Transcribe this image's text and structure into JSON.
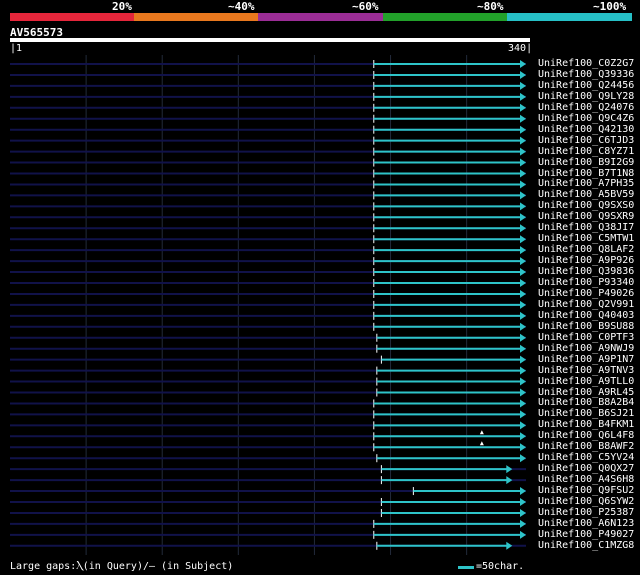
{
  "legend": {
    "labels": [
      "20%",
      "~40%",
      "~60%",
      "~80%",
      "~100%"
    ],
    "colors": [
      "#e5263b",
      "#e8781e",
      "#9b2d96",
      "#22a12a",
      "#26bfc6"
    ]
  },
  "query": {
    "name": "AV565573",
    "start": "1",
    "end": "340",
    "length": 340
  },
  "colors": {
    "background": "#000000",
    "grid": "#222a3a",
    "unaligned_line": "#11124a",
    "hit_line": "#2ec4c9",
    "text": "#ffffff"
  },
  "hits": [
    {
      "id": "UniRef100_C0Z2G7",
      "start": 240,
      "end": 340,
      "arrow": true
    },
    {
      "id": "UniRef100_Q39336",
      "start": 240,
      "end": 340,
      "arrow": true
    },
    {
      "id": "UniRef100_Q24456",
      "start": 240,
      "end": 340,
      "arrow": true
    },
    {
      "id": "UniRef100_Q9LY28",
      "start": 240,
      "end": 340,
      "arrow": true
    },
    {
      "id": "UniRef100_Q24076",
      "start": 240,
      "end": 340,
      "arrow": true
    },
    {
      "id": "UniRef100_Q9C4Z6",
      "start": 240,
      "end": 340,
      "arrow": true
    },
    {
      "id": "UniRef100_Q42130",
      "start": 240,
      "end": 340,
      "arrow": true
    },
    {
      "id": "UniRef100_C6TJD3",
      "start": 240,
      "end": 340,
      "arrow": true
    },
    {
      "id": "UniRef100_C8YZ71",
      "start": 240,
      "end": 340,
      "arrow": true
    },
    {
      "id": "UniRef100_B9I2G9",
      "start": 240,
      "end": 340,
      "arrow": true
    },
    {
      "id": "UniRef100_B7T1N8",
      "start": 240,
      "end": 340,
      "arrow": true
    },
    {
      "id": "UniRef100_A7PH35",
      "start": 240,
      "end": 340,
      "arrow": true
    },
    {
      "id": "UniRef100_A5BV59",
      "start": 240,
      "end": 340,
      "arrow": true
    },
    {
      "id": "UniRef100_Q9SXS0",
      "start": 240,
      "end": 340,
      "arrow": true
    },
    {
      "id": "UniRef100_Q9SXR9",
      "start": 240,
      "end": 340,
      "arrow": true
    },
    {
      "id": "UniRef100_Q38JI7",
      "start": 240,
      "end": 340,
      "arrow": true
    },
    {
      "id": "UniRef100_C5MTW1",
      "start": 240,
      "end": 340,
      "arrow": true
    },
    {
      "id": "UniRef100_Q8LAF2",
      "start": 240,
      "end": 340,
      "arrow": true
    },
    {
      "id": "UniRef100_A9P926",
      "start": 240,
      "end": 340,
      "arrow": true
    },
    {
      "id": "UniRef100_Q39836",
      "start": 240,
      "end": 340,
      "arrow": true
    },
    {
      "id": "UniRef100_P93340",
      "start": 240,
      "end": 340,
      "arrow": true
    },
    {
      "id": "UniRef100_P49026",
      "start": 240,
      "end": 340,
      "arrow": true
    },
    {
      "id": "UniRef100_Q2V991",
      "start": 240,
      "end": 340,
      "arrow": true
    },
    {
      "id": "UniRef100_Q40403",
      "start": 240,
      "end": 340,
      "arrow": true
    },
    {
      "id": "UniRef100_B9SU88",
      "start": 240,
      "end": 340,
      "arrow": true
    },
    {
      "id": "UniRef100_C0PTF3",
      "start": 242,
      "end": 340,
      "arrow": true
    },
    {
      "id": "UniRef100_A9NWJ9",
      "start": 242,
      "end": 340,
      "arrow": true
    },
    {
      "id": "UniRef100_A9P1N7",
      "start": 245,
      "end": 340,
      "arrow": true
    },
    {
      "id": "UniRef100_A9TNV3",
      "start": 242,
      "end": 340,
      "arrow": true
    },
    {
      "id": "UniRef100_A9TLL0",
      "start": 242,
      "end": 340,
      "arrow": true
    },
    {
      "id": "UniRef100_A9RL45",
      "start": 242,
      "end": 340,
      "arrow": true
    },
    {
      "id": "UniRef100_B8A2B4",
      "start": 240,
      "end": 340,
      "arrow": true
    },
    {
      "id": "UniRef100_B6SJ21",
      "start": 240,
      "end": 340,
      "arrow": true
    },
    {
      "id": "UniRef100_B4FKM1",
      "start": 240,
      "end": 340,
      "arrow": true
    },
    {
      "id": "UniRef100_Q6L4F8",
      "start": 240,
      "end": 340,
      "arrow": true
    },
    {
      "id": "UniRef100_B8AWF2",
      "start": 240,
      "end": 340,
      "arrow": true
    },
    {
      "id": "UniRef100_C5YV24",
      "start": 242,
      "end": 340,
      "arrow": true
    },
    {
      "id": "UniRef100_Q0QX27",
      "start": 245,
      "end": 331,
      "arrow": true
    },
    {
      "id": "UniRef100_A4S6H8",
      "start": 245,
      "end": 331,
      "arrow": true
    },
    {
      "id": "UniRef100_Q9FSU2",
      "start": 266,
      "end": 340,
      "arrow": true
    },
    {
      "id": "UniRef100_Q6SYW2",
      "start": 245,
      "end": 340,
      "arrow": true
    },
    {
      "id": "UniRef100_P25387",
      "start": 245,
      "end": 340,
      "arrow": true
    },
    {
      "id": "UniRef100_A6N123",
      "start": 240,
      "end": 340,
      "arrow": true
    },
    {
      "id": "UniRef100_P49027",
      "start": 240,
      "end": 340,
      "arrow": true
    },
    {
      "id": "UniRef100_C1MZG8",
      "start": 242,
      "end": 331,
      "arrow": true
    }
  ],
  "gap_markers": [
    {
      "row": 34,
      "pos": 311
    },
    {
      "row": 35,
      "pos": 311
    }
  ],
  "footer": {
    "text": "Large gaps:Ⲗ(in Query)/– (in Subject)",
    "scale_text": "=50char."
  }
}
